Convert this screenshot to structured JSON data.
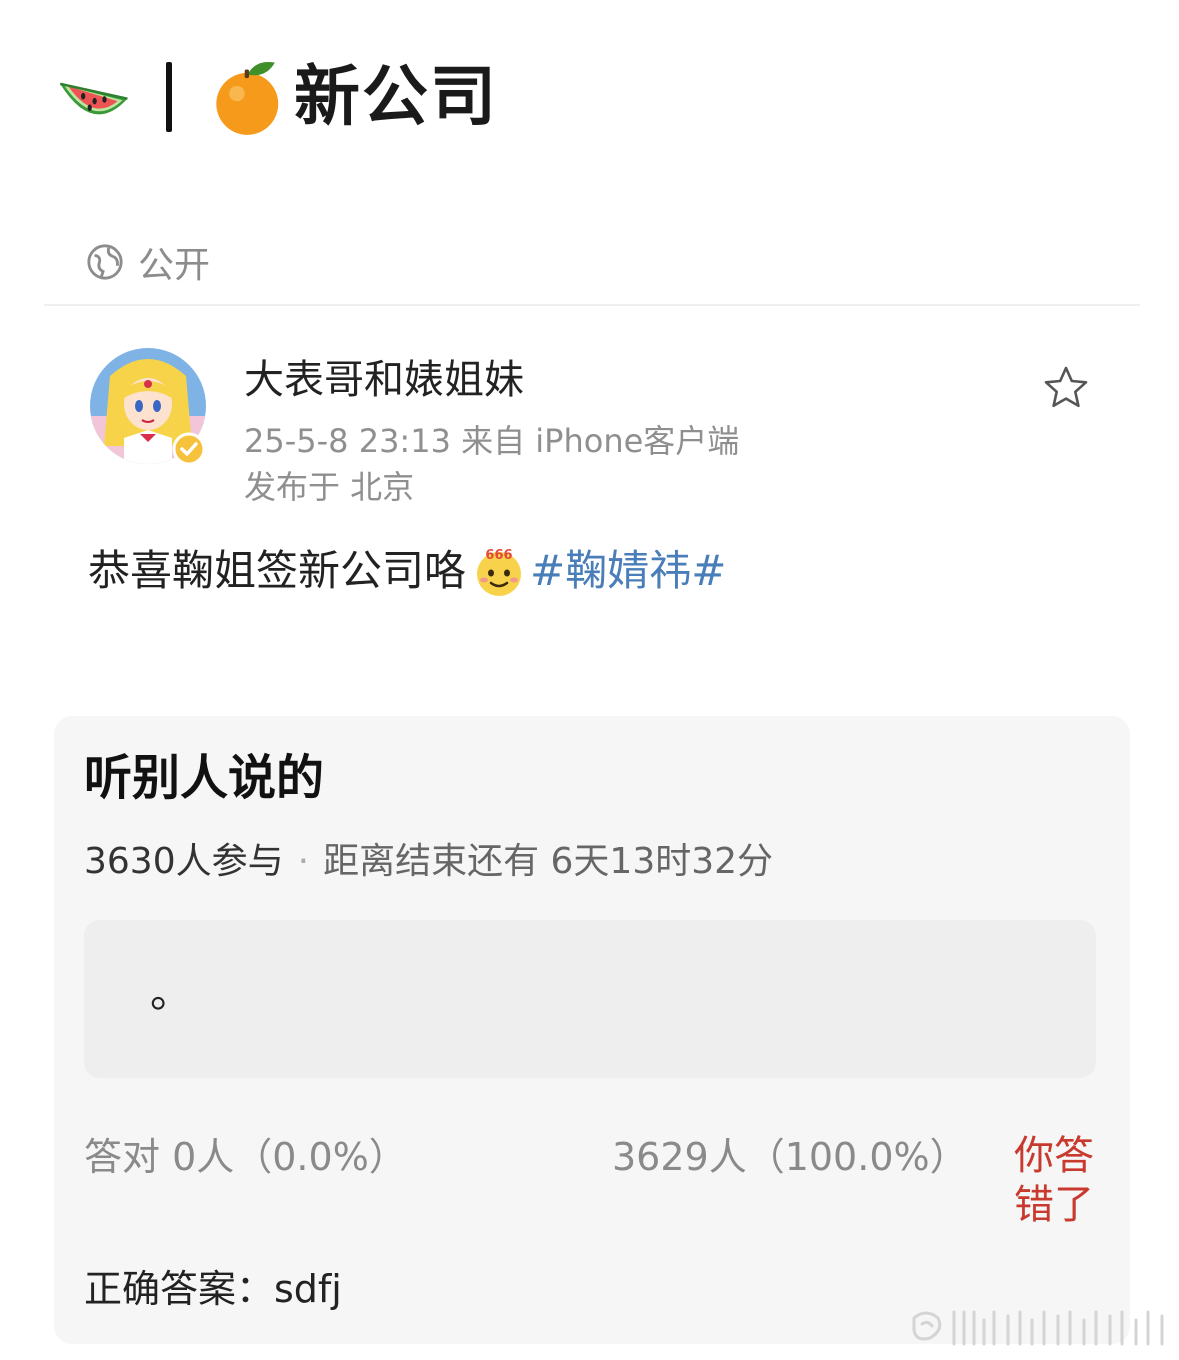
{
  "header": {
    "title": "新公司",
    "left_icon": "watermelon-icon",
    "right_icon": "tangerine-icon"
  },
  "visibility": {
    "icon": "globe-icon",
    "label": "公开"
  },
  "post": {
    "author": "大表哥和婊姐妹",
    "meta": "25-5-8 23:13  来自 iPhone客户端",
    "location": "发布于 北京",
    "text": "恭喜鞠姐签新公司咯",
    "emoji": "666-emoji",
    "hashtag": "#鞠婧祎#",
    "favorite_icon": "star-icon"
  },
  "quiz": {
    "title": "听别人说的",
    "participants": "3630人参与",
    "separator": "·",
    "time_left": "距离结束还有 6天13时32分",
    "answer_option": "。",
    "correct_result": "答对  0人（0.0%）",
    "wrong_result": "3629人（100.0%）",
    "wrong_label": "你答错了",
    "correct_answer": "正确答案：sdfj"
  },
  "colors": {
    "hashtag": "#4a7eb8",
    "wrong": "#c8392e",
    "card_background": "#f6f6f6"
  }
}
